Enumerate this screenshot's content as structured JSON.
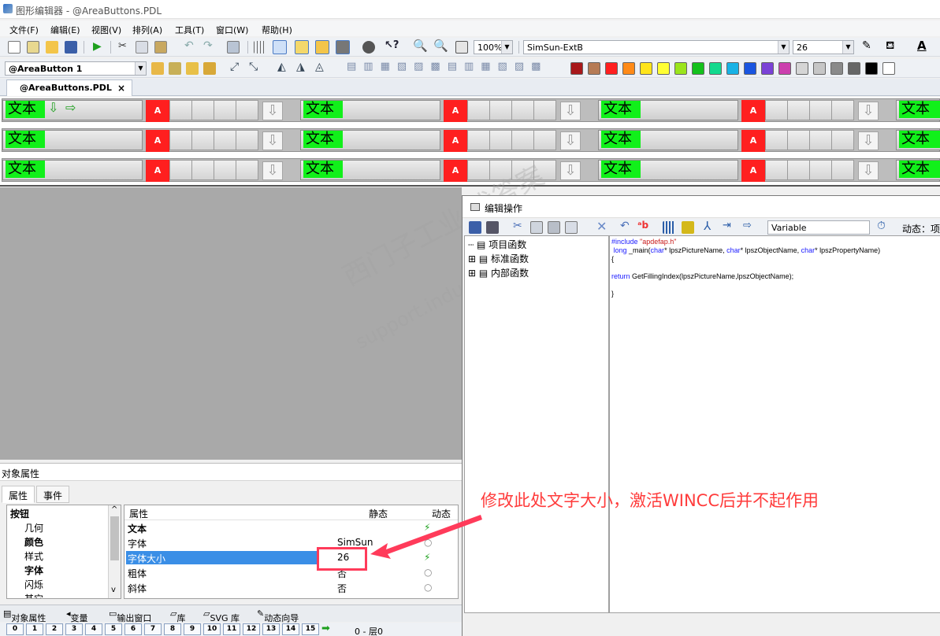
{
  "window": {
    "title": "图形编辑器 - @AreaButtons.PDL"
  },
  "menu": [
    "文件(F)",
    "编辑(E)",
    "视图(V)",
    "排列(A)",
    "工具(T)",
    "窗口(W)",
    "帮助(H)"
  ],
  "toolbar": {
    "zoom": "100%",
    "font_name": "SimSun-ExtB",
    "font_size": "26"
  },
  "toolbar2": {
    "object_selector": "@AreaButton 1"
  },
  "palette": [
    "#a8181a",
    "#b67b55",
    "#ff1f1f",
    "#ff8a17",
    "#ffe41a",
    "#ffff33",
    "#9be51c",
    "#14c11c",
    "#13d98e",
    "#18b2e5",
    "#1a55e0",
    "#7b42d6",
    "#cc3fae",
    "#d5d5d5",
    "#c6c6c6",
    "#8a8a8a",
    "#666666",
    "#000000",
    "#ffffff"
  ],
  "doc_tab": {
    "label": "@AreaButtons.PDL",
    "close": "×"
  },
  "canvas": {
    "button_text": "文本",
    "red_label": "A"
  },
  "editor": {
    "title": "编辑操作",
    "variable_field": "Variable",
    "dynamic_label": "动态：项",
    "tree": [
      "项目函数",
      "标准函数",
      "内部函数"
    ],
    "code": {
      "include_kw": "#include ",
      "include_file": "\"apdefap.h\"",
      "sig_kw1": "long",
      "sig_mid": " _main(",
      "char": "char",
      "p1": "* lpszPictureName, ",
      "p2": "* lpszObjectName, ",
      "p3": "* lpszPropertyName)",
      "open": "{",
      "ret_kw": "return",
      "ret_body": " GetFillingIndex(lpszPictureName,lpszObjectName);",
      "close": "}"
    }
  },
  "watermark": {
    "cn": "西门子工业  找答案",
    "url": "support.industry.siemens.com/cs"
  },
  "properties": {
    "header": "对象属性",
    "tabs": [
      "属性",
      "事件"
    ],
    "tree": [
      "按钮",
      "几何",
      "颜色",
      "样式",
      "字体",
      "闪烁",
      "其它"
    ],
    "columns": [
      "属性",
      "静态",
      "动态"
    ],
    "rows": [
      {
        "name": "文本",
        "static": "",
        "dyn": "⚡"
      },
      {
        "name": "字体",
        "static": "SimSun",
        "dyn": "○"
      },
      {
        "name": "字体大小",
        "static": "26",
        "dyn": "⚡"
      },
      {
        "name": "粗体",
        "static": "否",
        "dyn": "○"
      },
      {
        "name": "斜体",
        "static": "否",
        "dyn": "○"
      }
    ]
  },
  "bottom_tabs": [
    "对象属性",
    "变量",
    "输出窗口",
    "库",
    "SVG 库",
    "动态向导"
  ],
  "layers": {
    "numbers": [
      "0",
      "1",
      "2",
      "3",
      "4",
      "5",
      "6",
      "7",
      "8",
      "9",
      "10",
      "11",
      "12",
      "13",
      "14",
      "15"
    ],
    "current": "0 - 层0"
  },
  "annotation": "修改此处文字大小，激活WINCC后并不起作用"
}
